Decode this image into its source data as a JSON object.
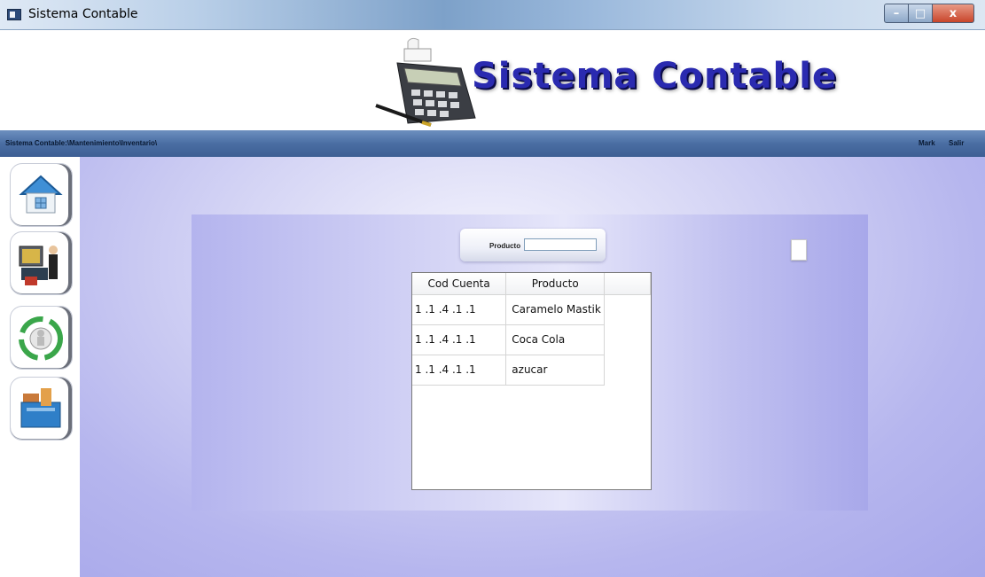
{
  "window": {
    "title": "Sistema Contable",
    "controls": {
      "minimize": "–",
      "maximize": "□",
      "close": "x"
    }
  },
  "header": {
    "logo_text": "Sistema Contable",
    "logo_icon": "calculator-with-pen-icon"
  },
  "navbar": {
    "breadcrumb": "Sistema Contable:\\Mantenimiento\\Inventario\\",
    "user": "Mark",
    "logout": "Salir"
  },
  "sidebar": {
    "items": [
      {
        "name": "home",
        "icon": "house-icon"
      },
      {
        "name": "people",
        "icon": "people-computer-icon"
      },
      {
        "name": "cycle",
        "icon": "recycle-arrows-icon"
      },
      {
        "name": "files",
        "icon": "folder-files-icon"
      }
    ]
  },
  "search": {
    "label": "Producto",
    "value": ""
  },
  "table": {
    "columns": [
      "Cod Cuenta",
      "Producto",
      ""
    ],
    "rows": [
      {
        "cod": "1 .1 .4 .1 .1",
        "producto": "Caramelo Mastik"
      },
      {
        "cod": "1 .1 .4 .1 .1",
        "producto": "Coca Cola"
      },
      {
        "cod": "1 .1 .4 .1 .1",
        "producto": " azucar"
      }
    ]
  },
  "colors": {
    "navbar": "#4a6ea3",
    "background": "#b6b6ee",
    "logo_text": "#2a2ab0"
  }
}
